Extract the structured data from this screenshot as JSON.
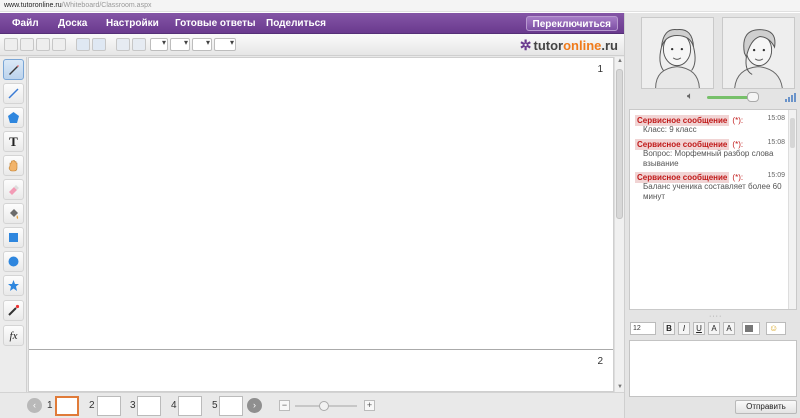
{
  "browser": {
    "host": "www.tutoronline.ru",
    "path": "/Whiteboard/Classroom.aspx"
  },
  "menu": {
    "items": [
      "Файл",
      "Доска",
      "Настройки",
      "Готовые ответы",
      "Поделиться"
    ],
    "switch_label": "Переключиться"
  },
  "brand": {
    "logo_prefix": "tutor",
    "logo_highlight": "online",
    "logo_suffix": ".ru",
    "accent": "#6a3a8e",
    "highlight": "#f07a1a"
  },
  "tools": [
    "pencil-icon",
    "line-icon",
    "pentagon-icon",
    "text-icon",
    "hand-icon",
    "eraser-icon",
    "fill-icon",
    "square-icon",
    "circle-icon",
    "star-icon",
    "laser-pointer-icon",
    "formula-icon"
  ],
  "tool_labels": {
    "text": "T",
    "formula": "fx"
  },
  "board": {
    "page1_number": "1",
    "page2_number": "2"
  },
  "pages": {
    "thumbnails": [
      "1",
      "2",
      "3",
      "4",
      "5"
    ],
    "current": "1",
    "zoom_minus": "−",
    "zoom_plus": "+",
    "prev": "‹",
    "next": "›"
  },
  "chat": {
    "messages": [
      {
        "tag": "Сервисное сообщение",
        "star": "(*):",
        "time": "15:08",
        "text": "Класс: 9 класс"
      },
      {
        "tag": "Сервисное сообщение",
        "star": "(*):",
        "time": "15:08",
        "text": "Вопрос: Морфемный разбор слова взывание"
      },
      {
        "tag": "Сервисное сообщение",
        "star": "(*):",
        "time": "15:09",
        "text": "Баланс ученика составляет более 60 минут"
      }
    ],
    "font_size": "12",
    "format_buttons": [
      "B",
      "I",
      "U",
      "A",
      "A"
    ],
    "send_label": "Отправить"
  }
}
